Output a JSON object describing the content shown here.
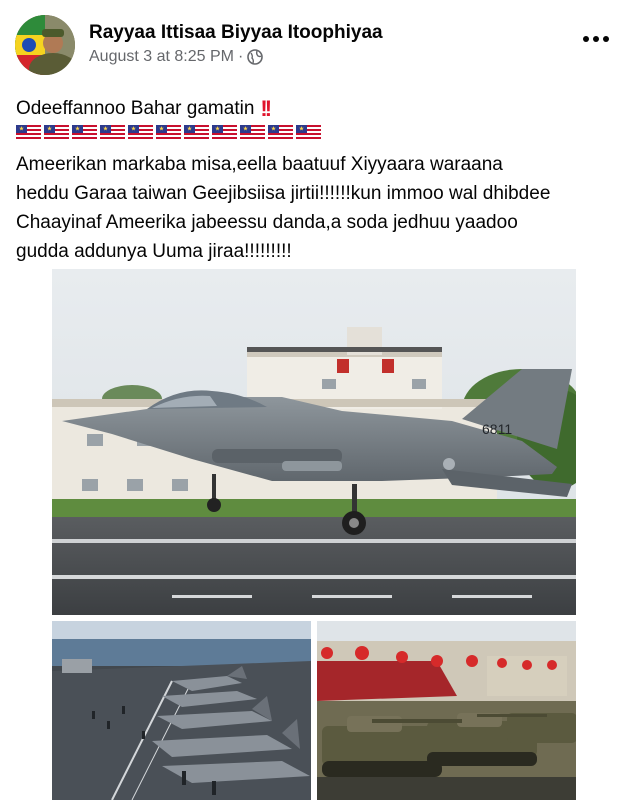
{
  "post": {
    "author": "Rayyaa Ittisaa Biyyaa Itoophiyaa",
    "timestamp": "August 3 at 8:25 PM",
    "separator": "·",
    "audience_icon": "globe-icon",
    "more_icon": "more-options-icon",
    "title": "Odeeffannoo Bahar gamatin",
    "title_emoji": "!!",
    "flag_emoji_count": 11,
    "body_lines": [
      "Ameerikan markaba misa,eella baatuuf Xiyyaara waraana",
      "heddu Garaa taiwan Geejibsiisa jirtii!!!!!!kun immoo wal dhibdee",
      "Chaayinaf Ameerika jabeessu danda,a soda jedhuu yaadoo",
      "gudda addunya Uuma jiraa!!!!!!!!!"
    ]
  },
  "photos": {
    "main_tail_number": "6811"
  },
  "colors": {
    "text": "#050505",
    "meta": "#65676b",
    "emoji_red": "#e0142c"
  }
}
